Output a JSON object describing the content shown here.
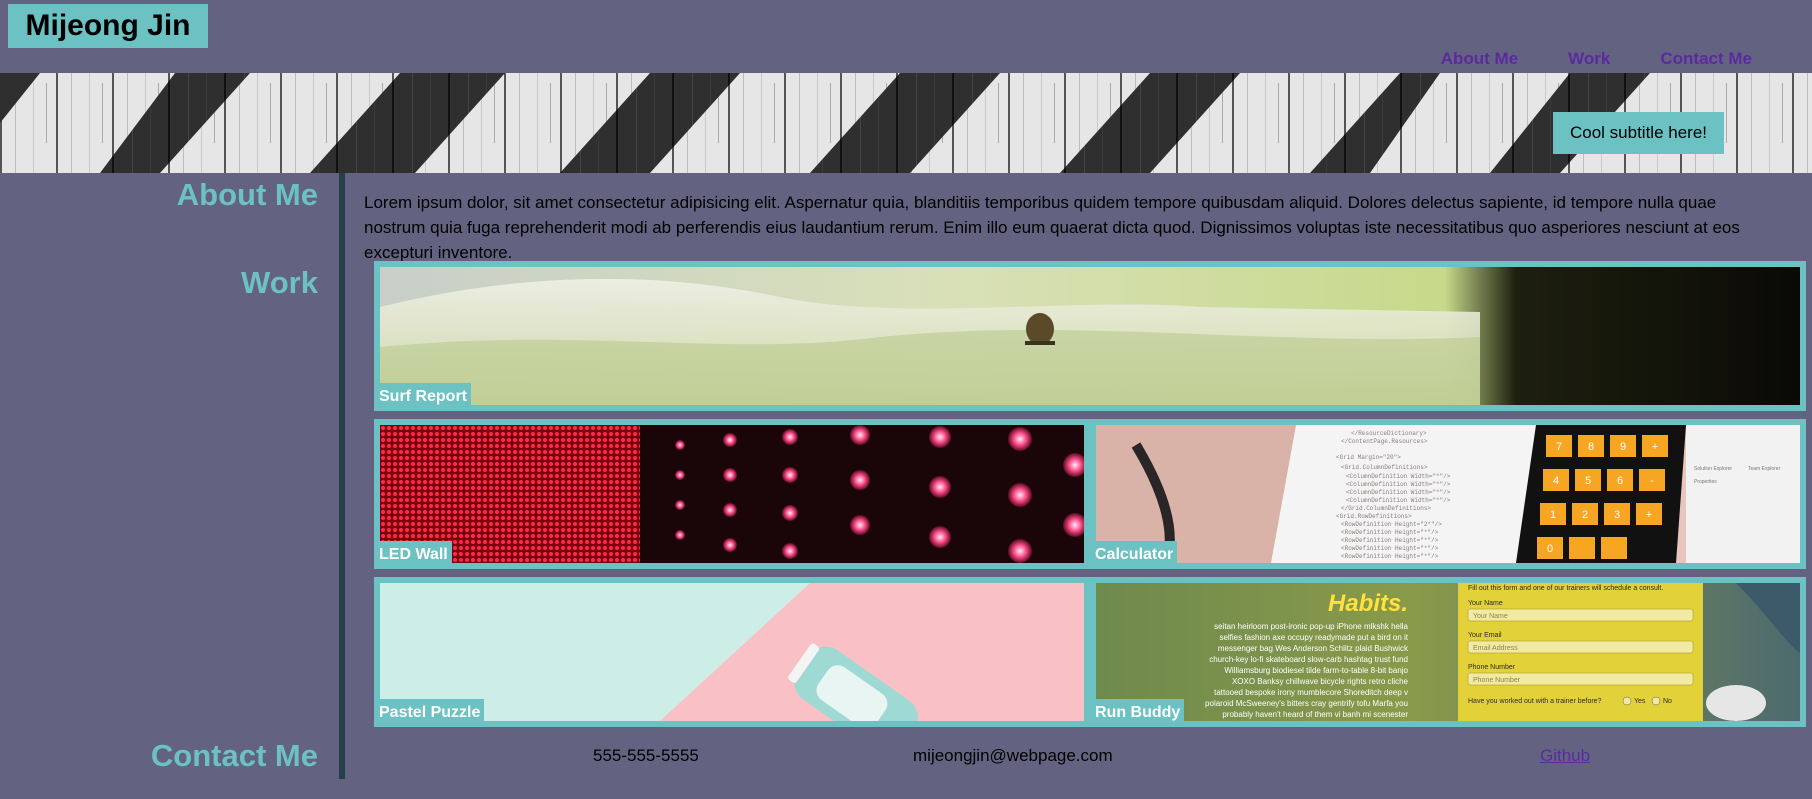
{
  "header": {
    "brand": "Mijeong Jin",
    "nav": [
      "About Me",
      "Work",
      "Contact Me"
    ],
    "subtitle": "Cool subtitle here!"
  },
  "sections": {
    "about_heading": "About Me",
    "about_text": "Lorem ipsum dolor, sit amet consectetur adipisicing elit. Aspernatur quia, blanditiis temporibus quidem tempore quibusdam aliquid. Dolores delectus sapiente, id tempore nulla quae nostrum quia fuga reprehenderit modi ab perferendis eius laudantium rerum. Enim illo eum quaerat dicta quod. Dignissimos voluptas iste necessitatibus quo asperiores nesciunt at eos excepturi inventore.",
    "work_heading": "Work",
    "contact_heading": "Contact Me"
  },
  "work": {
    "surf": "Surf Report",
    "led": "LED Wall",
    "calc": "Calculator",
    "pastel": "Pastel Puzzle",
    "run": "Run Buddy"
  },
  "run_buddy_screenshot": {
    "habits": "Habits.",
    "intro": "Fill out this form and one of our trainers will schedule a consult.",
    "name_label": "Your Name",
    "name_placeholder": "Your Name",
    "email_label": "Your Email",
    "email_placeholder": "Email Address",
    "phone_label": "Phone Number",
    "phone_placeholder": "Phone Number",
    "question": "Have you worked out with a trainer before?",
    "yes": "Yes",
    "no": "No",
    "body_lines": [
      "seitan heirloom post-ironic pop-up iPhone mlkshk hella",
      "selfies fashion axe occupy readymade put a bird on it",
      "messenger bag Wes Anderson Schlitz plaid Bushwick",
      "church-key lo-fi skateboard slow-carb hashtag trust fund",
      "Williamsburg biodiesel tilde farm-to-table 8-bit banjo",
      "XOXO Banksy chillwave bicycle rights retro cliche",
      "tattooed bespoke irony mumblecore Shoreditch deep v",
      "polaroid McSweeney's bitters cray gentrify tofu Marfa you",
      "probably haven't heard of them vi banh mi scenester"
    ]
  },
  "calculator_screenshot": {
    "keys": [
      "7",
      "8",
      "9",
      "+",
      "4",
      "5",
      "6",
      "-",
      "1",
      "2",
      "3",
      "+",
      "0"
    ],
    "code_lines": [
      "</ResourceDictionary>",
      "</ContentPage.Resources>",
      "<Grid Margin=\"20\">",
      "<Grid.ColumnDefinitions>",
      "<ColumnDefinition Width=\"*\"/>",
      "<ColumnDefinition Width=\"*\"/>",
      "<ColumnDefinition Width=\"*\"/>",
      "<ColumnDefinition Width=\"*\"/>",
      "</Grid.ColumnDefinitions>",
      "<Grid.RowDefinitions>",
      "<RowDefinition Height=\"2*\"/>",
      "<RowDefinition Height=\"*\"/>",
      "<RowDefinition Height=\"*\"/>",
      "<RowDefinition Height=\"*\"/>",
      "<RowDefinition Height=\"*\"/>"
    ],
    "panel_items": [
      "Solution Explorer",
      "Team Explorer",
      "Properties"
    ]
  },
  "contact": {
    "phone": "555-555-5555",
    "email": "mijeongjin@webpage.com",
    "github": "Github"
  },
  "colors": {
    "background": "#636381",
    "accent": "#6cc1c3",
    "link": "#5b2a9e",
    "divider": "#26404a"
  }
}
